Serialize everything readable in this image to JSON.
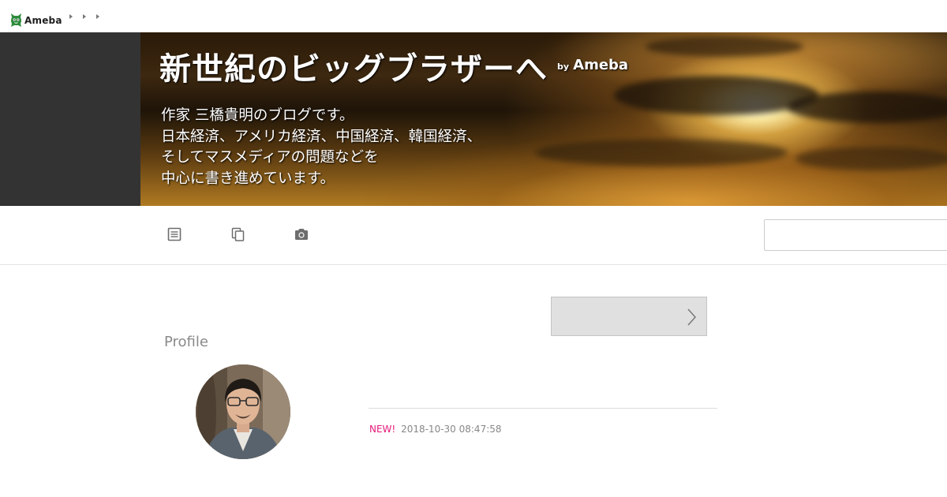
{
  "header": {
    "logo_text": "Ameba",
    "breadcrumb_count": 3
  },
  "banner": {
    "title": "新世紀のビッグブラザーへ",
    "by_label": "by",
    "by_brand": "Ameba",
    "description": [
      "作家 三橋貴明のブログです。",
      "日本経済、アメリカ経済、中国経済、韓国経済、",
      "そしてマスメディアの問題などを",
      "中心に書き進めています。"
    ]
  },
  "nav": {
    "icons": [
      "article-list-icon",
      "theme-list-icon",
      "camera-icon"
    ],
    "search_value": ""
  },
  "profile": {
    "heading": "Profile"
  },
  "follow_button": {
    "label": ""
  },
  "latest_entry": {
    "new_badge": "NEW!",
    "timestamp": "2018-10-30 08:47:58"
  },
  "colors": {
    "accent_new": "#e5197a",
    "header_dark": "#333333",
    "logo_green": "#2d8c3c"
  }
}
